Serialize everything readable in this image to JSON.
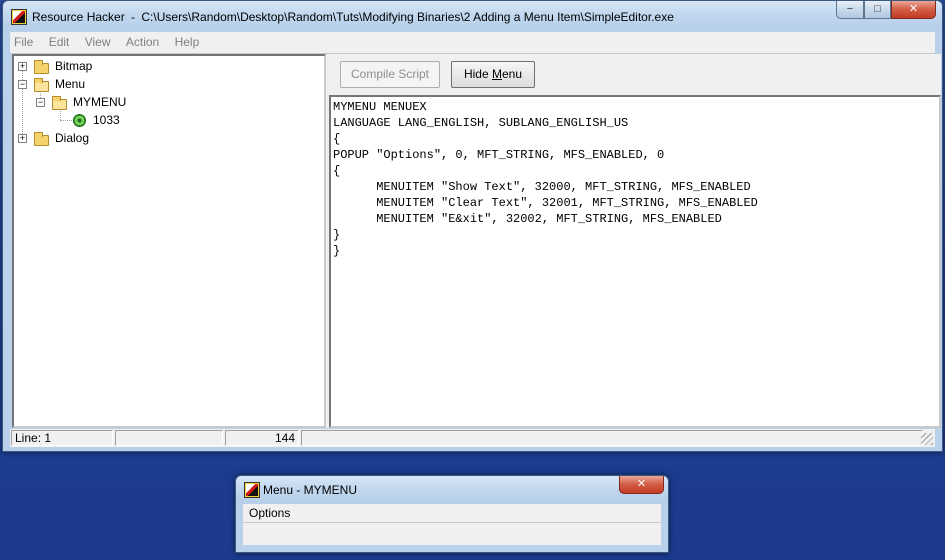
{
  "main_window": {
    "app_name": "Resource Hacker",
    "separator": "-",
    "file_path": "C:\\Users\\Random\\Desktop\\Random\\Tuts\\Modifying Binaries\\2 Adding a Menu Item\\SimpleEditor.exe",
    "caption_buttons": {
      "minimize": "−",
      "maximize": "□",
      "close": "✕"
    }
  },
  "menu_bar": [
    {
      "label": "File"
    },
    {
      "label": "Edit"
    },
    {
      "label": "View"
    },
    {
      "label": "Action"
    },
    {
      "label": "Help"
    }
  ],
  "tree": {
    "bitmap": "Bitmap",
    "menu": "Menu",
    "mymenu": "MYMENU",
    "lang_1033": "1033",
    "dialog": "Dialog",
    "expanders": {
      "collapsed": "+",
      "expanded": "−"
    }
  },
  "toolbar": {
    "compile_script": "Compile Script",
    "hide_menu_prefix": "Hide ",
    "hide_menu_accel": "M",
    "hide_menu_suffix": "enu"
  },
  "script_lines": [
    "MYMENU MENUEX",
    "LANGUAGE LANG_ENGLISH, SUBLANG_ENGLISH_US",
    "{",
    "POPUP \"Options\", 0, MFT_STRING, MFS_ENABLED, 0",
    "{",
    "      MENUITEM \"Show Text\", 32000, MFT_STRING, MFS_ENABLED",
    "      MENUITEM \"Clear Text\", 32001, MFT_STRING, MFS_ENABLED",
    "      MENUITEM \"E&xit\", 32002, MFT_STRING, MFS_ENABLED",
    "}",
    "}"
  ],
  "status_bar": {
    "line": "Line: 1",
    "blank": "",
    "count": "144"
  },
  "preview_window": {
    "title": "Menu -  MYMENU",
    "menu_item": "Options",
    "close": "✕"
  },
  "icons": {
    "app": "resource-hacker-icon",
    "folder": "folder-icon",
    "resource": "gear-icon"
  }
}
